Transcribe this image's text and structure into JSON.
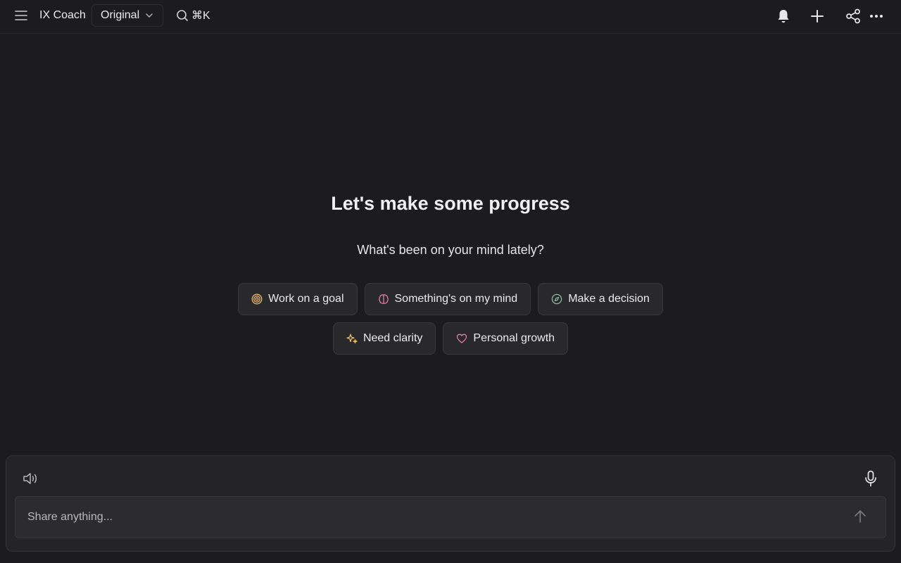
{
  "header": {
    "app_title": "IX Coach",
    "model_selected": "Original",
    "search_shortcut": "⌘K",
    "icons": {
      "menu": "hamburger-menu-icon",
      "search": "search-icon",
      "notifications": "bell-icon",
      "new": "plus-icon",
      "share": "share-icon",
      "more": "ellipsis-icon"
    }
  },
  "hero": {
    "title": "Let's make some progress",
    "subtitle": "What's been on your mind lately?"
  },
  "prompts": {
    "row1": [
      {
        "label": "Work on a goal",
        "icon": "target-icon",
        "color": "#e8b86d"
      },
      {
        "label": "Something's on my mind",
        "icon": "brain-icon",
        "color": "#e57aa0"
      },
      {
        "label": "Make a decision",
        "icon": "compass-icon",
        "color": "#8fb8a6"
      }
    ],
    "row2": [
      {
        "label": "Need clarity",
        "icon": "sparkles-icon",
        "color": "#f0c061"
      },
      {
        "label": "Personal growth",
        "icon": "heart-icon",
        "color": "#e57aa0"
      }
    ]
  },
  "composer": {
    "placeholder": "Share anything...",
    "value": "",
    "icons": {
      "speaker": "speaker-icon",
      "mic": "microphone-icon",
      "send": "arrow-up-icon"
    }
  },
  "colors": {
    "background": "#1c1c1e",
    "chip_bg": "#29292c",
    "composer_bg": "#242427"
  }
}
